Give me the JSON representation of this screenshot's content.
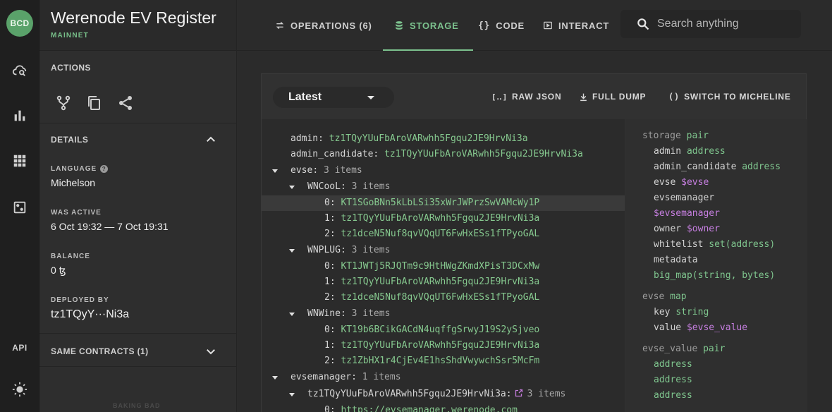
{
  "rail": {
    "logo": "BCD",
    "api_label": "API"
  },
  "side": {
    "title": "Werenode EV Register",
    "network": "MAINNET",
    "actions_label": "ACTIONS",
    "details_label": "DETAILS",
    "language_label": "LANGUAGE",
    "language_value": "Michelson",
    "was_active_label": "WAS ACTIVE",
    "was_active_value": "6 Oct 19:32 — 7 Oct 19:31",
    "balance_label": "BALANCE",
    "balance_value": "0 ꜩ",
    "deployed_by_label": "DEPLOYED BY",
    "deployed_by_value": "tz1TQyY···Ni3a",
    "same_contracts_label": "SAME CONTRACTS (1)",
    "footer_note": "BAKING BAD"
  },
  "tabs": [
    {
      "label": "OPERATIONS (6)"
    },
    {
      "label": "STORAGE"
    },
    {
      "label": "CODE"
    },
    {
      "label": "INTERACT"
    }
  ],
  "search": {
    "placeholder": "Search anything"
  },
  "toolbar": {
    "select_value": "Latest",
    "raw_json": "RAW JSON",
    "full_dump": "FULL DUMP",
    "switch": "SWITCH TO MICHELINE"
  },
  "storage_rows": [
    {
      "key": "admin",
      "value": "tz1TQyYUuFbAroVARwhh5Fgqu2JE9HrvNi3a"
    },
    {
      "key": "admin_candidate",
      "value": "tz1TQyYUuFbAroVARwhh5Fgqu2JE9HrvNi3a"
    },
    {
      "key": "evse",
      "count": "3 items"
    },
    {
      "key": "WNCooL",
      "count": "3 items"
    },
    {
      "key": "0",
      "value": "KT1SGoBNn5kLbLSi35xWrJWPrzSwVAMcWy1P"
    },
    {
      "key": "1",
      "value": "tz1TQyYUuFbAroVARwhh5Fgqu2JE9HrvNi3a"
    },
    {
      "key": "2",
      "value": "tz1dceN5Nuf8qvVQqUT6FwHxESs1fTPyoGAL"
    },
    {
      "key": "WNPLUG",
      "count": "3 items"
    },
    {
      "key": "0",
      "value": "KT1JWTj5RJQTm9c9HtHWgZKmdXPisT3DCxMw"
    },
    {
      "key": "1",
      "value": "tz1TQyYUuFbAroVARwhh5Fgqu2JE9HrvNi3a"
    },
    {
      "key": "2",
      "value": "tz1dceN5Nuf8qvVQqUT6FwHxESs1fTPyoGAL"
    },
    {
      "key": "WNWine",
      "count": "3 items"
    },
    {
      "key": "0",
      "value": "KT19b6BCikGACdN4uqffgSrwyJ19S2ySjveo"
    },
    {
      "key": "1",
      "value": "tz1TQyYUuFbAroVARwhh5Fgqu2JE9HrvNi3a"
    },
    {
      "key": "2",
      "value": "tz1ZbHX1r4CjEv4E1hsShdVwywchSsr5McFm"
    },
    {
      "key": "evsemanager",
      "count": "1 items"
    },
    {
      "key": "tz1TQyYUuFbAroVARwhh5Fgqu2JE9HrvNi3a",
      "count": "3 items"
    },
    {
      "key": "0",
      "value": "https://evsemanager.werenode.com"
    }
  ],
  "types": {
    "storage_kw": "storage",
    "storage_type": "pair",
    "admin": "admin",
    "admin_type": "address",
    "admin_candidate": "admin_candidate",
    "admin_candidate_type": "address",
    "evse": "evse",
    "evse_type": "$evse",
    "evsemanager": "evsemanager",
    "evsemanager_type": "$evsemanager",
    "owner": "owner",
    "owner_type": "$owner",
    "whitelist": "whitelist",
    "whitelist_type": "set(address)",
    "metadata": "metadata",
    "metadata_type": "big_map(string, bytes)",
    "evse_kw": "evse",
    "evse_map": "map",
    "key": "key",
    "key_type": "string",
    "value": "value",
    "value_type": "$evse_value",
    "evse_value_kw": "evse_value",
    "evse_value_type": "pair",
    "addr1": "address",
    "addr2": "address",
    "addr3": "address"
  },
  "colors": {
    "accent": "#7cc28e",
    "value_green": "#86c98f",
    "type_ref": "#c67fe0"
  }
}
